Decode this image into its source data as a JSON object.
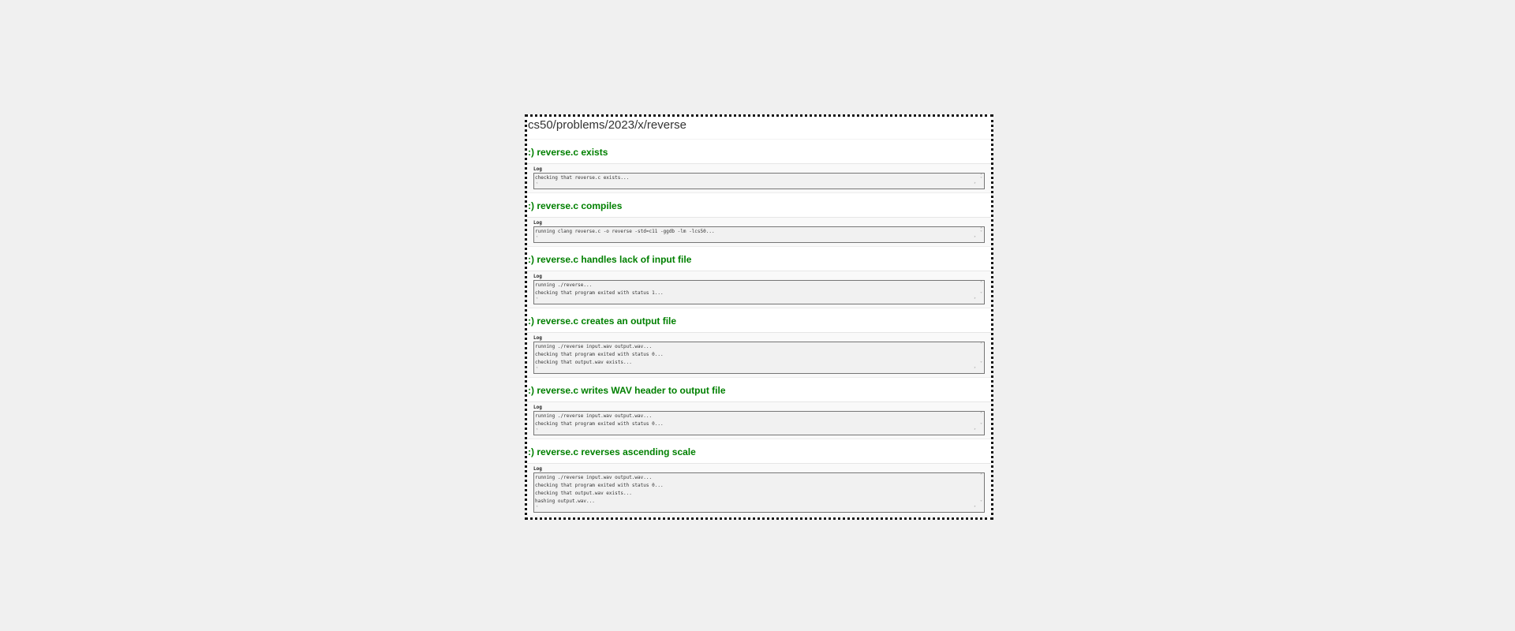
{
  "page": {
    "title": "cs50/problems/2023/x/reverse"
  },
  "checks": [
    {
      "title": ":) reverse.c exists",
      "log_label": "Log",
      "log": [
        "checking that reverse.c exists..."
      ]
    },
    {
      "title": ":) reverse.c compiles",
      "log_label": "Log",
      "log": [
        "running clang reverse.c -o reverse -std=c11 -ggdb -lm -lcs50..."
      ]
    },
    {
      "title": ":) reverse.c handles lack of input file",
      "log_label": "Log",
      "log": [
        "running ./reverse...",
        "checking that program exited with status 1..."
      ]
    },
    {
      "title": ":) reverse.c creates an output file",
      "log_label": "Log",
      "log": [
        "running ./reverse input.wav output.wav...",
        "checking that program exited with status 0...",
        "checking that output.wav exists..."
      ]
    },
    {
      "title": ":) reverse.c writes WAV header to output file",
      "log_label": "Log",
      "log": [
        "running ./reverse input.wav output.wav...",
        "checking that program exited with status 0..."
      ]
    },
    {
      "title": ":) reverse.c reverses ascending scale",
      "log_label": "Log",
      "log": [
        "running ./reverse input.wav output.wav...",
        "checking that program exited with status 0...",
        "checking that output.wav exists...",
        "hashing output.wav..."
      ]
    }
  ],
  "colors": {
    "pass_green": "#008000",
    "background": "#f0f0f0",
    "log_background": "#f1f1f1"
  },
  "icons": {
    "scroll_up": "scroll-up-arrow-icon",
    "scroll_down": "scroll-down-arrow-icon",
    "scroll_left": "scroll-left-arrow-icon",
    "scroll_right": "scroll-right-arrow-icon"
  }
}
